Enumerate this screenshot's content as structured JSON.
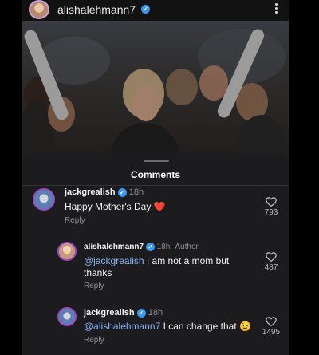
{
  "post": {
    "username": "alishalehmann7"
  },
  "sheet": {
    "title": "Comments"
  },
  "comments": [
    {
      "username": "jackgrealish",
      "time": "18h",
      "author_tag": "",
      "mention": "",
      "text": "Happy Mother's Day ",
      "emoji": "❤️",
      "reply_label": "Reply",
      "likes": "793"
    },
    {
      "username": "alishalehmann7",
      "time": "18h",
      "author_tag": "Author",
      "mention": "@jackgrealish",
      "text": " I am not a mom but thanks",
      "emoji": "",
      "reply_label": "Reply",
      "likes": "487"
    },
    {
      "username": "jackgrealish",
      "time": "18h",
      "author_tag": "",
      "mention": "@alishalehmann7",
      "text": " I can change that ",
      "emoji": "😉",
      "reply_label": "Reply",
      "likes": "1495"
    }
  ],
  "colors": {
    "accent_blue": "#3897f0",
    "heart_red": "#e0245e",
    "sheet_bg": "#1c1c1e"
  },
  "icons": [
    "more-vertical-icon",
    "verified-badge-icon",
    "heart-outline-icon"
  ]
}
